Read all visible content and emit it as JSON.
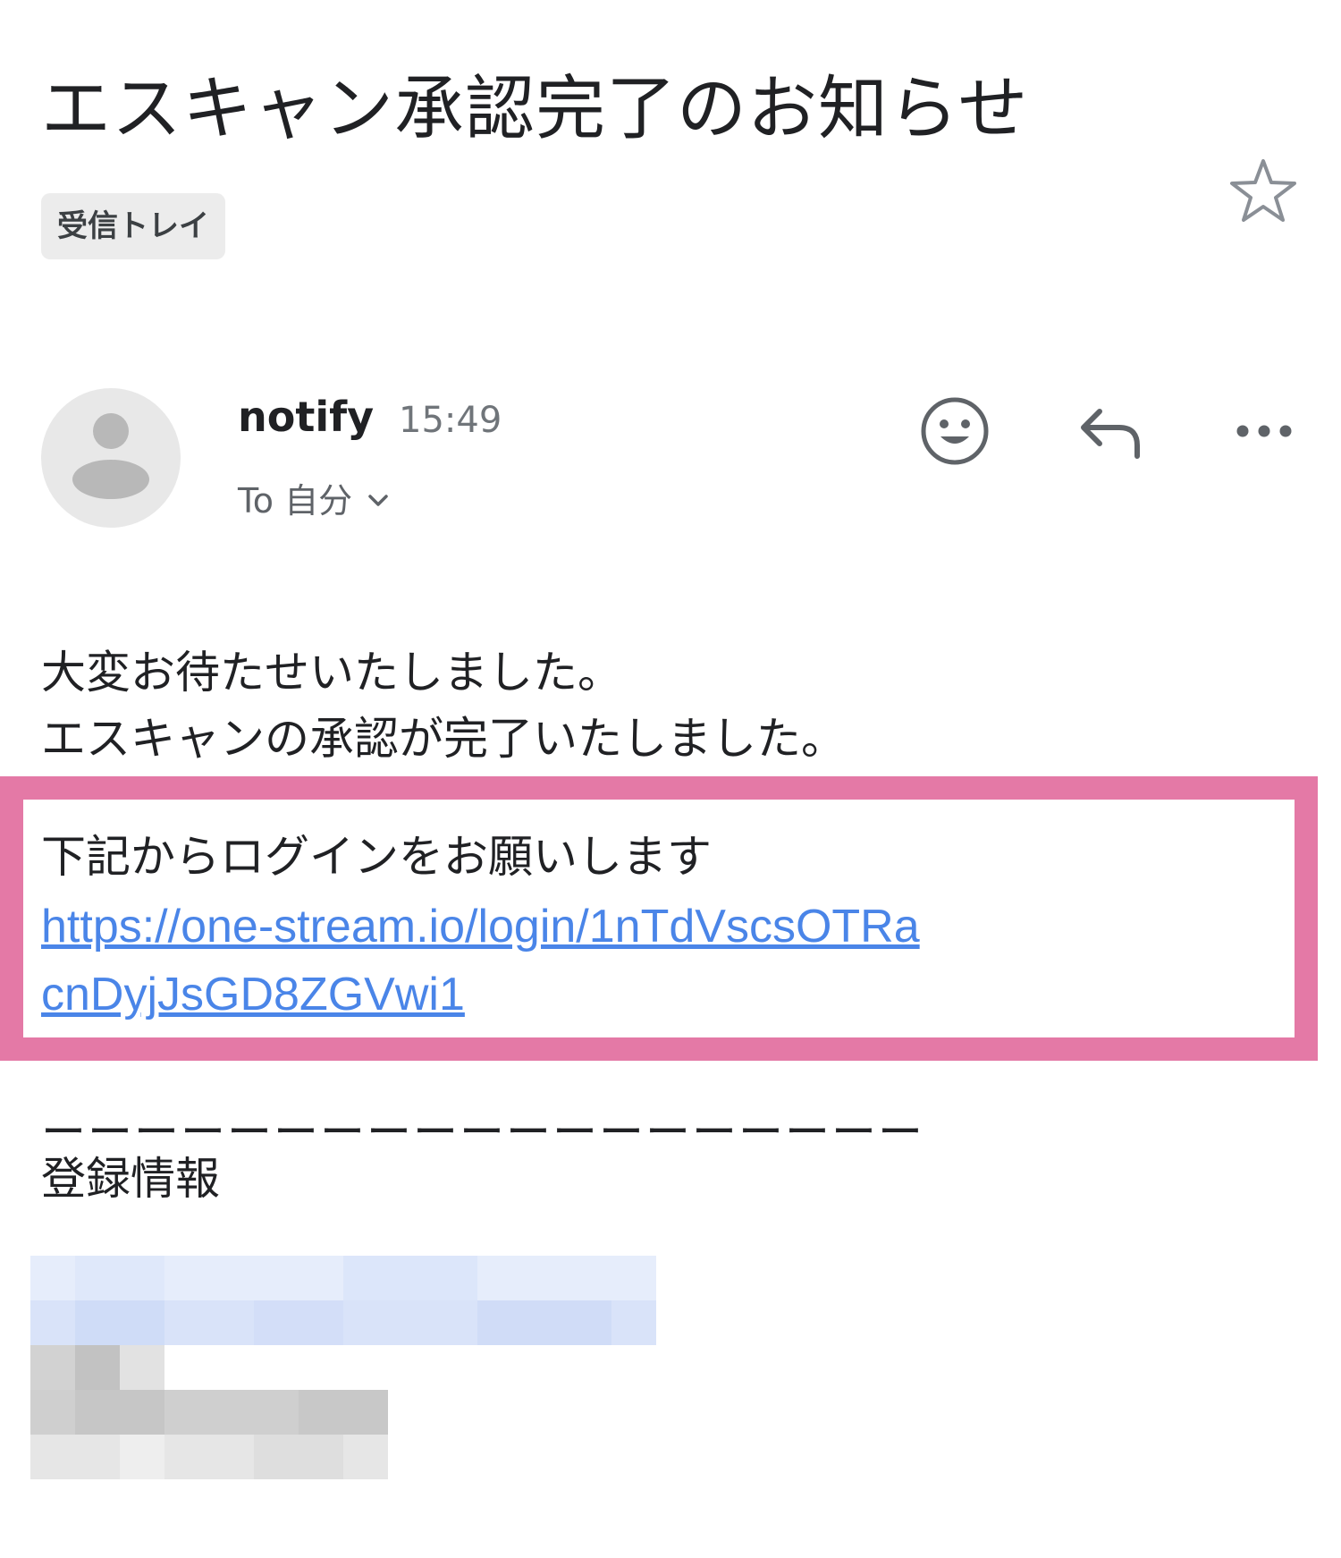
{
  "email": {
    "subject": "エスキャン承認完了のお知らせ",
    "label": "受信トレイ",
    "sender": {
      "name": "notify",
      "time": "15:49",
      "recipient": "To 自分"
    },
    "body": {
      "line1": "大変お待たせいたしました。",
      "line2": "エスキャンの承認が完了いたしました。",
      "login_prompt": "下記からログインをお願いします",
      "login_url": "https://one-stream.io/login/1nTdVscsOTRacnDyjJsGD8ZGVwi1",
      "separator": "ーーーーーーーーーーーーーーーーーーー",
      "registration_heading": "登録情報"
    }
  },
  "icons": {
    "star": "star-outline-icon",
    "avatar": "person-avatar-icon",
    "emoji": "emoji-reaction-icon",
    "reply": "reply-arrow-icon",
    "more": "more-horizontal-icon",
    "dropdown": "chevron-down-icon"
  },
  "colors": {
    "highlight_border": "#e479a6",
    "link": "#4a85e8",
    "chip_background": "#ececec",
    "avatar_background": "#e8e8e8"
  }
}
